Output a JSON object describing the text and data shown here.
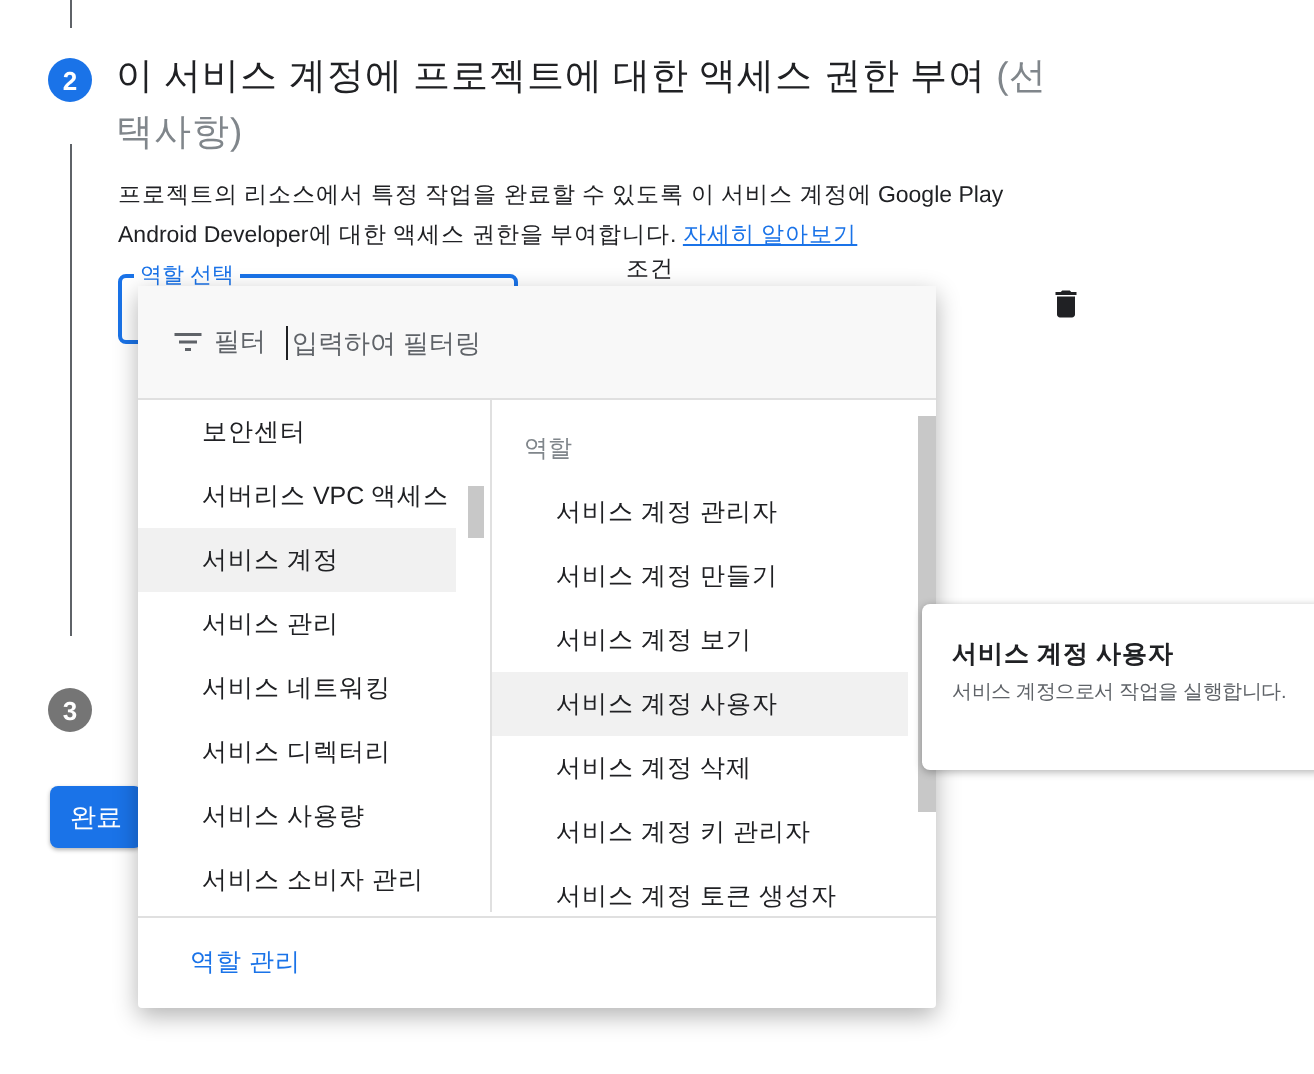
{
  "step2": {
    "number": "2",
    "title": "이 서비스 계정에 프로젝트에 대한 액세스 권한 부여",
    "title_optional": "(선택사항)",
    "description": "프로젝트의 리소스에서 특정 작업을 완료할 수 있도록 이 서비스 계정에 Google Play Android Developer에 대한 액세스 권한을 부여합니다.",
    "learn_more_link": "자세히 알아보기"
  },
  "role_field": {
    "label": "역할 선택"
  },
  "condition_label": "조건",
  "dropdown": {
    "filter_label": "필터",
    "filter_placeholder": "입력하여 필터링",
    "categories": [
      {
        "label": "보안센터",
        "selected": false
      },
      {
        "label": "서버리스 VPC 액세스",
        "selected": false
      },
      {
        "label": "서비스 계정",
        "selected": true
      },
      {
        "label": "서비스 관리",
        "selected": false
      },
      {
        "label": "서비스 네트워킹",
        "selected": false
      },
      {
        "label": "서비스 디렉터리",
        "selected": false
      },
      {
        "label": "서비스 사용량",
        "selected": false
      },
      {
        "label": "서비스 소비자 관리",
        "selected": false
      }
    ],
    "roles_header": "역할",
    "roles": [
      {
        "label": "서비스 계정 관리자",
        "selected": false
      },
      {
        "label": "서비스 계정 만들기",
        "selected": false
      },
      {
        "label": "서비스 계정 보기",
        "selected": false
      },
      {
        "label": "서비스 계정 사용자",
        "selected": true
      },
      {
        "label": "서비스 계정 삭제",
        "selected": false
      },
      {
        "label": "서비스 계정 키 관리자",
        "selected": false
      },
      {
        "label": "서비스 계정 토큰 생성자",
        "selected": false
      }
    ],
    "manage_roles_link": "역할 관리"
  },
  "tooltip": {
    "title": "서비스 계정 사용자",
    "description": "서비스 계정으로서 작업을 실행합니다."
  },
  "step3": {
    "number": "3"
  },
  "done_button": "완료"
}
